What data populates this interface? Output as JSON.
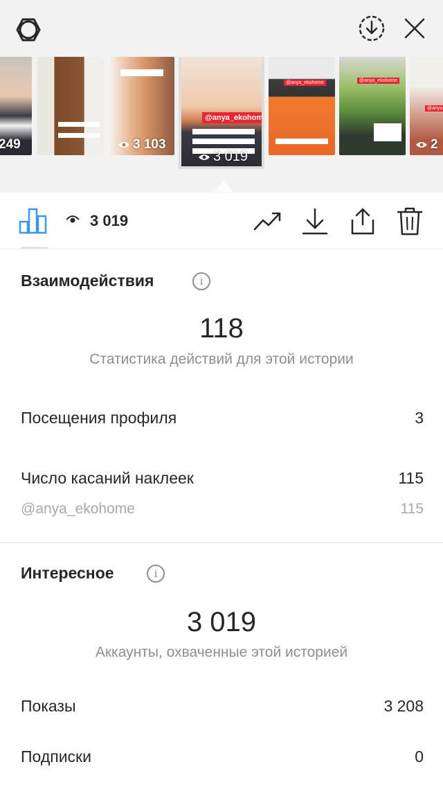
{
  "header": {
    "settings_icon": "gear-icon",
    "download_icon": "download-circle-icon",
    "close_icon": "close-icon"
  },
  "thumbnails": [
    {
      "views": "249"
    },
    {
      "views": ""
    },
    {
      "views": "3 103"
    },
    {
      "views": "3 019",
      "tag": "@anya_ekohome",
      "active": true
    },
    {
      "views": ""
    },
    {
      "views": ""
    },
    {
      "views": "2"
    }
  ],
  "actions": {
    "reach_value": "3 019"
  },
  "interactions": {
    "title": "Взаимодействия",
    "total": "118",
    "total_caption": "Статистика действий для этой истории",
    "rows": [
      {
        "label": "Посещения профиля",
        "value": "3"
      },
      {
        "label": "Число касаний наклеек",
        "value": "115"
      }
    ],
    "sub_rows": [
      {
        "label": "@anya_ekohome",
        "value": "115"
      }
    ]
  },
  "discovery": {
    "title": "Интересное",
    "total": "3 019",
    "total_caption": "Аккаунты, охваченные этой историей",
    "rows": [
      {
        "label": "Показы",
        "value": "3 208"
      },
      {
        "label": "Подписки",
        "value": "0"
      }
    ]
  }
}
